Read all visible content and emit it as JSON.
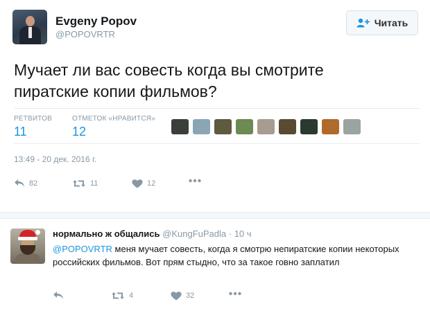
{
  "tweet": {
    "author_name": "Evgeny Popov",
    "author_handle": "@POPOVRTR",
    "follow_label": "Читать",
    "text": "Мучает ли вас совесть когда вы смотрите пиратские копии фильмов?",
    "stats": {
      "retweets_label": "РЕТВИТОВ",
      "retweets_count": "11",
      "likes_label": "ОТМЕТОК «НРАВИТСЯ»",
      "likes_count": "12"
    },
    "liker_avatar_colors": [
      "#3b3f3a",
      "#8aa6b5",
      "#5d5a3f",
      "#6c8a52",
      "#a89b90",
      "#5a4a32",
      "#2a3a2e",
      "#b06a2c",
      "#9aa4a0"
    ],
    "timestamp": "13:49 - 20 дек. 2016 г.",
    "actions": {
      "reply_count": "82",
      "retweet_count": "11",
      "like_count": "12"
    }
  },
  "reply": {
    "author_name": "нормально ж общались",
    "author_handle": "@KungFuPadla",
    "time": "· 10 ч",
    "mention": "@POPOVRTR",
    "text": " меня мучает совесть, когда я смотрю непиратские копии некоторых российских фильмов. Вот прям стыдно, что за такое говно заплатил",
    "actions": {
      "retweet_count": "4",
      "like_count": "32"
    }
  },
  "colors": {
    "accent": "#1b95e0",
    "muted": "#8899a6",
    "text": "#14171a"
  }
}
